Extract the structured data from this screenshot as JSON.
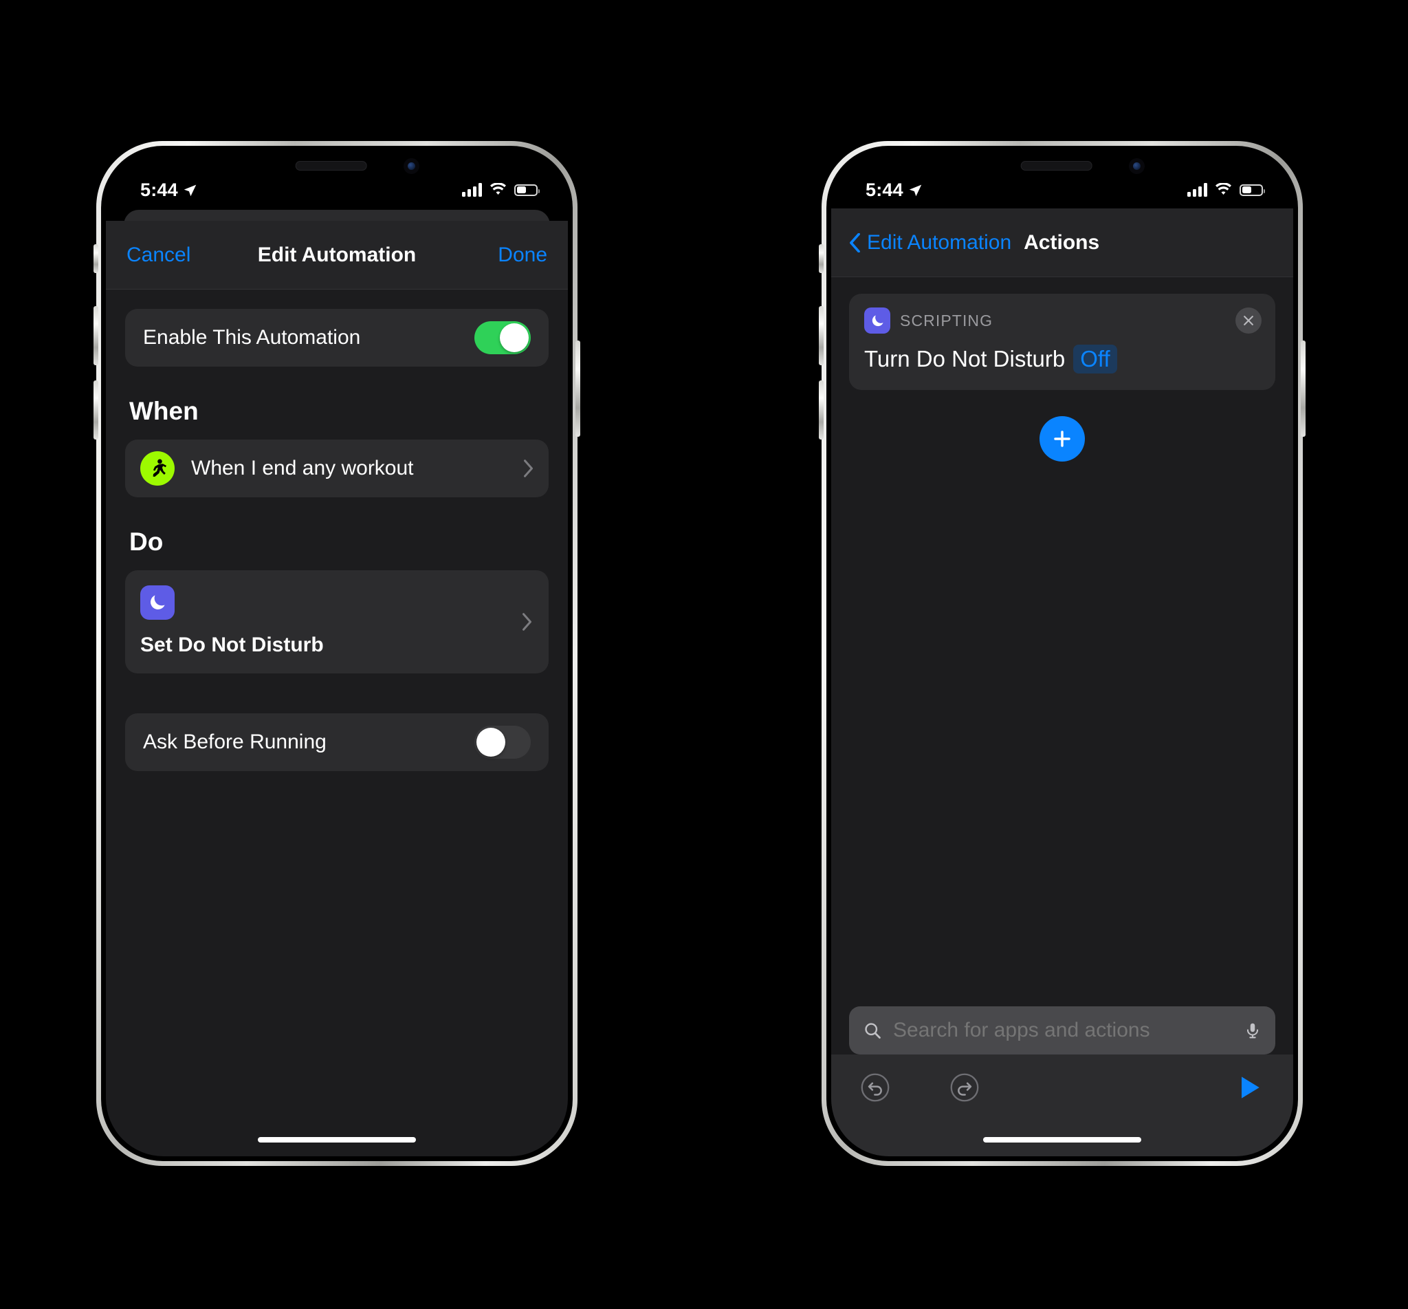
{
  "status_bar": {
    "time": "5:44",
    "location_icon": "location-arrow-icon",
    "cellular_icon": "cellular-bars-icon",
    "wifi_icon": "wifi-icon",
    "battery_icon": "battery-icon"
  },
  "colors": {
    "accent_blue": "#0a84ff",
    "toggle_green": "#2fd158",
    "workout_green": "#9dfa00",
    "dnd_purple": "#5e5ce6",
    "card_bg": "#2c2c2e",
    "screen_bg": "#1c1c1e",
    "navbar_bg": "#252527"
  },
  "edit_automation_screen": {
    "nav": {
      "cancel_label": "Cancel",
      "title": "Edit Automation",
      "done_label": "Done"
    },
    "enable_row": {
      "label": "Enable This Automation",
      "toggle_state": "on"
    },
    "when_section": {
      "header": "When",
      "trigger": {
        "label": "When I end any workout",
        "icon": "running-person-icon",
        "chevron": "chevron-right-icon"
      }
    },
    "do_section": {
      "header": "Do",
      "action": {
        "title": "Set Do Not Disturb",
        "icon": "moon-icon",
        "chevron": "chevron-right-icon"
      }
    },
    "ask_row": {
      "label": "Ask Before Running",
      "toggle_state": "off"
    }
  },
  "actions_screen": {
    "nav": {
      "back_label": "Edit Automation",
      "back_icon": "chevron-left-icon",
      "title": "Actions"
    },
    "action_card": {
      "category": "SCRIPTING",
      "icon": "moon-icon",
      "title": "Turn Do Not Disturb",
      "token_value": "Off",
      "close_icon": "close-circle-icon"
    },
    "add_button": {
      "icon": "plus-icon",
      "label": "+"
    },
    "search": {
      "placeholder": "Search for apps and actions",
      "search_icon": "search-icon",
      "mic_icon": "microphone-icon"
    },
    "toolbar": {
      "undo_icon": "undo-icon",
      "redo_icon": "redo-icon",
      "run_icon": "play-icon"
    }
  }
}
